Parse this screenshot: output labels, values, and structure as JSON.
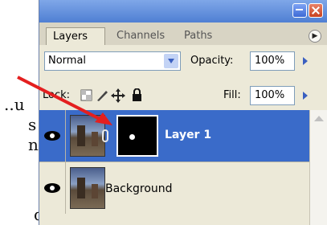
{
  "document_fragments": [
    "..u",
    "s",
    "n",
    "",
    "d"
  ],
  "palette": {
    "tabs": [
      {
        "label": "Layers",
        "active": true
      },
      {
        "label": "Channels",
        "active": false
      },
      {
        "label": "Paths",
        "active": false
      }
    ],
    "blend_mode": "Normal",
    "opacity_label": "Opacity:",
    "opacity_value": "100%",
    "lock_label": "Lock:",
    "fill_label": "Fill:",
    "fill_value": "100%",
    "layers": [
      {
        "name": "Layer 1",
        "selected": true,
        "visible": true,
        "has_mask": true
      },
      {
        "name": "Background",
        "selected": false,
        "visible": true,
        "has_mask": false
      }
    ],
    "icons": [
      "eye-icon",
      "link-icon",
      "lock-transparent-icon",
      "lock-brush-icon",
      "move-icon",
      "lock-all-icon",
      "palette-menu-icon"
    ]
  },
  "colors": {
    "selected_row": "#3a6bc9",
    "annotation_arrow": "#e41f1f",
    "title_bar": "#5a86d8"
  }
}
